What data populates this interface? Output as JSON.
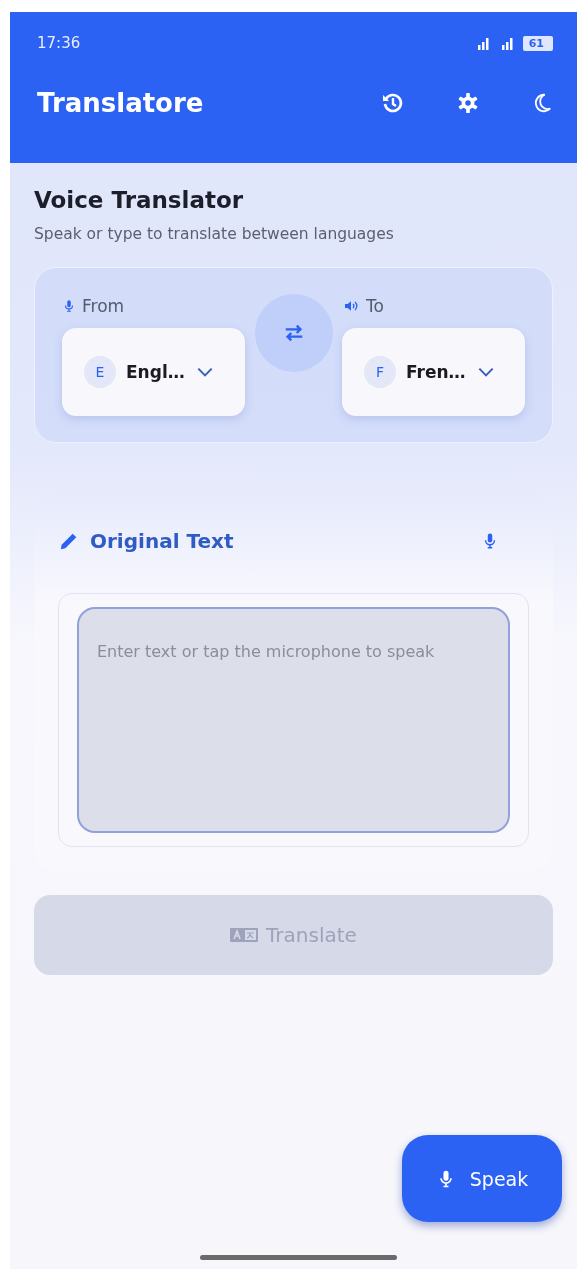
{
  "status_bar": {
    "time": "17:36",
    "battery": "61"
  },
  "app_bar": {
    "title": "Translatore"
  },
  "header": {
    "title": "Voice Translator",
    "subtitle": "Speak or type to translate between languages"
  },
  "languages": [
    {
      "kind": "from",
      "label": "From",
      "initial": "E",
      "value": "Engl…"
    },
    {
      "kind": "to",
      "label": "To",
      "initial": "F",
      "value": "Fren…"
    }
  ],
  "original_text": {
    "title": "Original Text",
    "placeholder": "Enter text or tap the microphone to speak"
  },
  "translate_button": {
    "label": "Translate",
    "disabled": true
  },
  "speak_button": {
    "label": "Speak"
  }
}
